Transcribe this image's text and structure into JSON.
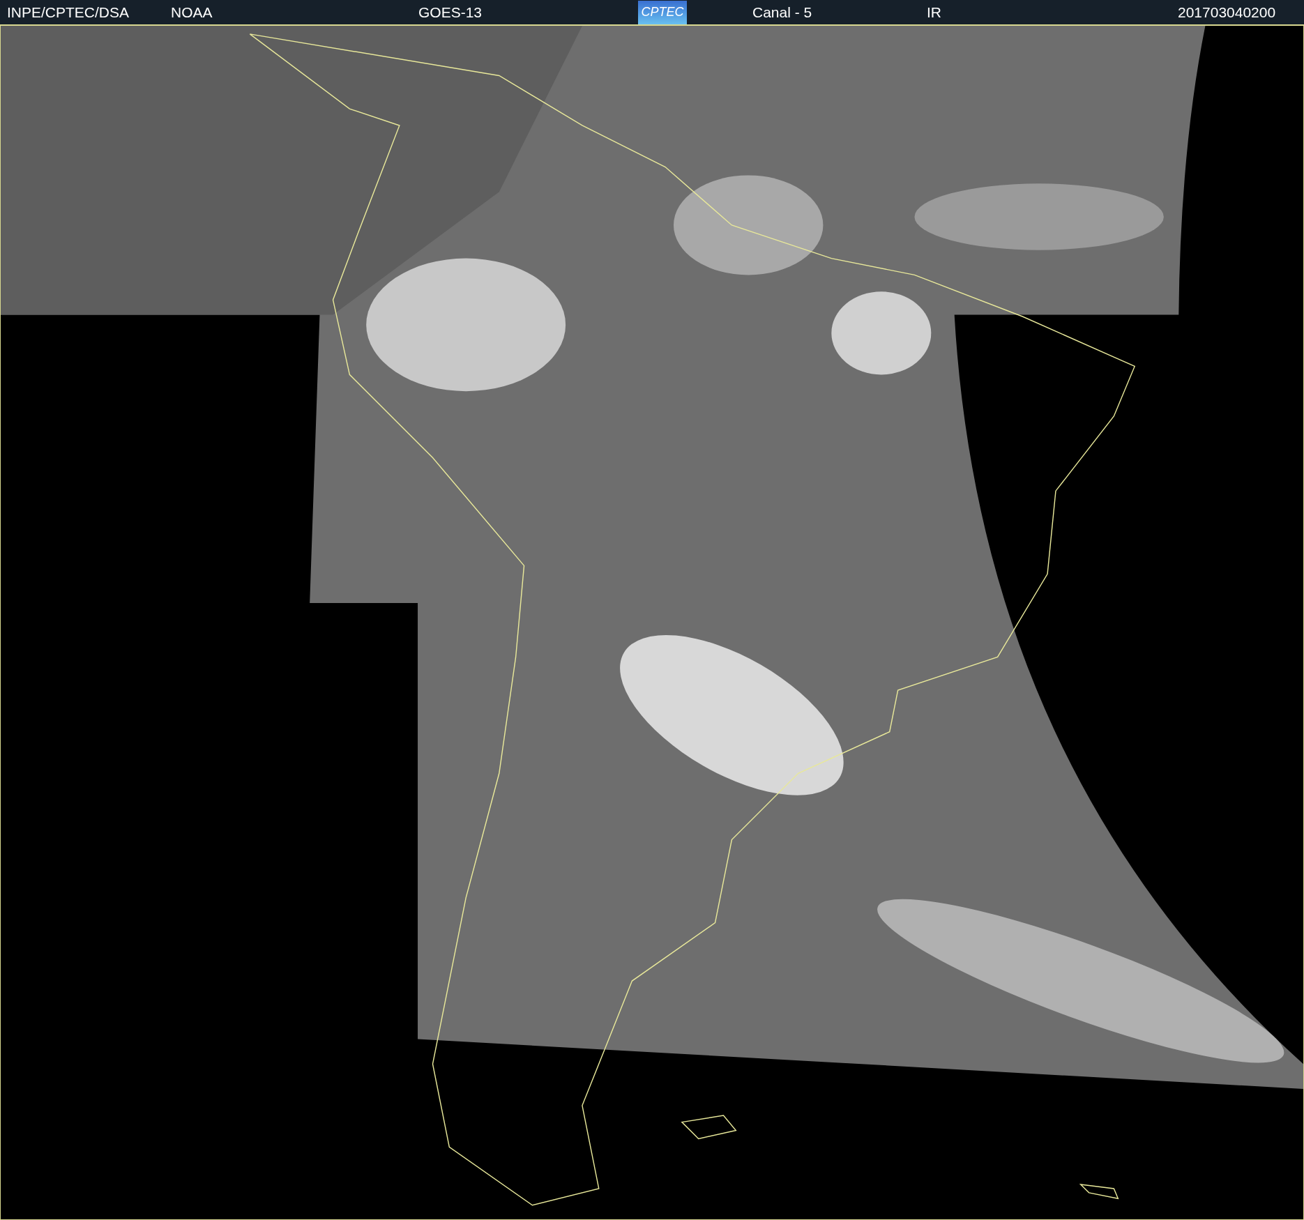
{
  "header": {
    "source": "INPE/CPTEC/DSA",
    "agency": "NOAA",
    "satellite": "GOES-13",
    "logo": "CPTEC",
    "channel": "Canal - 5",
    "band": "IR",
    "timestamp": "201703040200"
  }
}
